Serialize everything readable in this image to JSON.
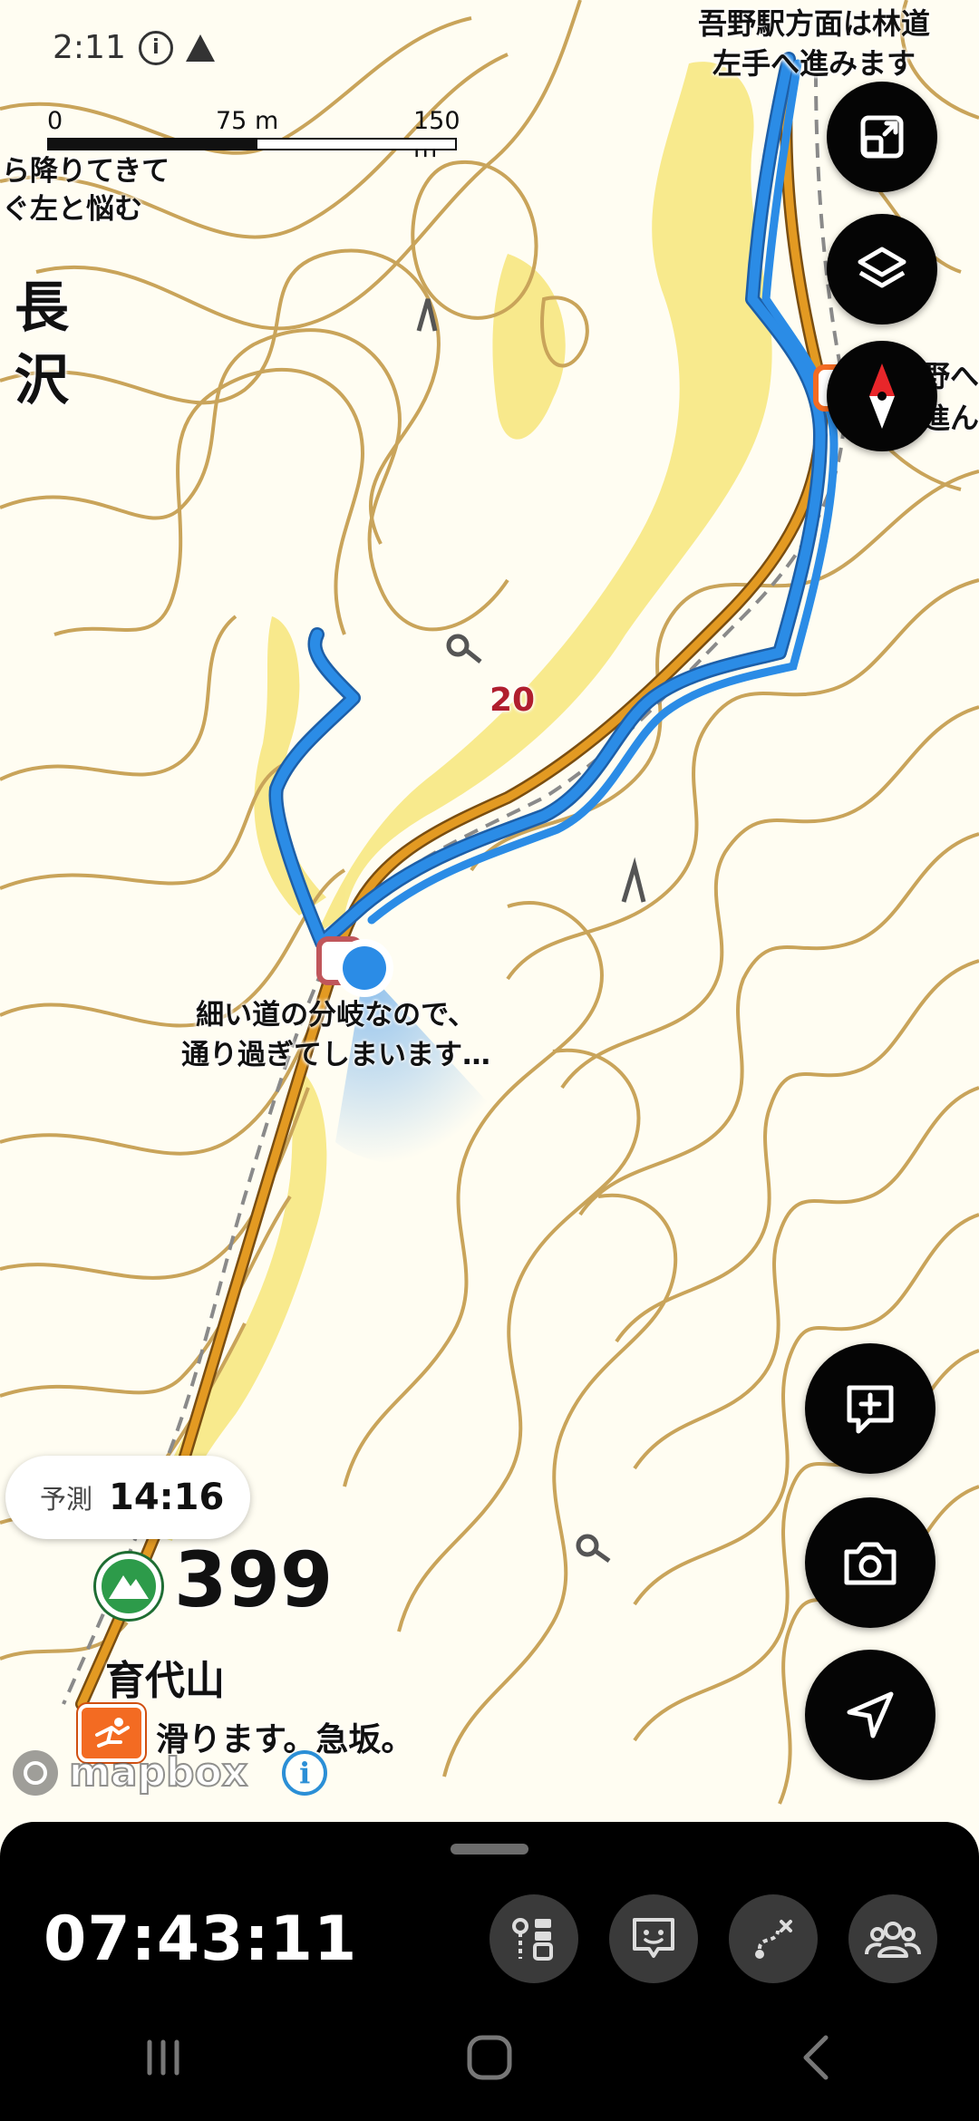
{
  "status_bar": {
    "time": "2:11",
    "info_icon": "info-circle-icon",
    "alert_icon": "triangle-icon"
  },
  "scale_bar": {
    "labels": [
      "0",
      "75 m",
      "150 m"
    ]
  },
  "map_labels": {
    "top_right_note_line1": "吾野駅方面は林道",
    "top_right_note_line2": "左手へ進みます",
    "left_note_line1": "ら降りてきて",
    "left_note_line2": "ぐ左と悩む",
    "place_name_line1": "長",
    "place_name_line2": "沢",
    "right_note_line1": "野へ",
    "right_note_line2": "進ん",
    "waypoint_number": "20",
    "branch_note_line1": "細い道の分岐なので、",
    "branch_note_line2": "通り過ぎてしまいます…"
  },
  "prediction": {
    "label": "予測",
    "time": "14:16"
  },
  "summit": {
    "elevation": "399",
    "name": "育代山",
    "icon": "mountain-icon"
  },
  "hazard": {
    "text": "滑ります。急坂。",
    "icon": "slip-hazard-icon"
  },
  "attribution": {
    "brand": "mapbox"
  },
  "bottom_panel": {
    "elapsed_time": "07:43:11",
    "tools": [
      "route-distance-icon",
      "feedback-icon",
      "route-edit-icon",
      "group-icon"
    ]
  },
  "colors": {
    "track_blue": "#2b8ce6",
    "route_orange": "#e39a22",
    "contour": "#c9a45a",
    "highlight_yellow": "#f5df55",
    "panel_bg": "#000000"
  }
}
